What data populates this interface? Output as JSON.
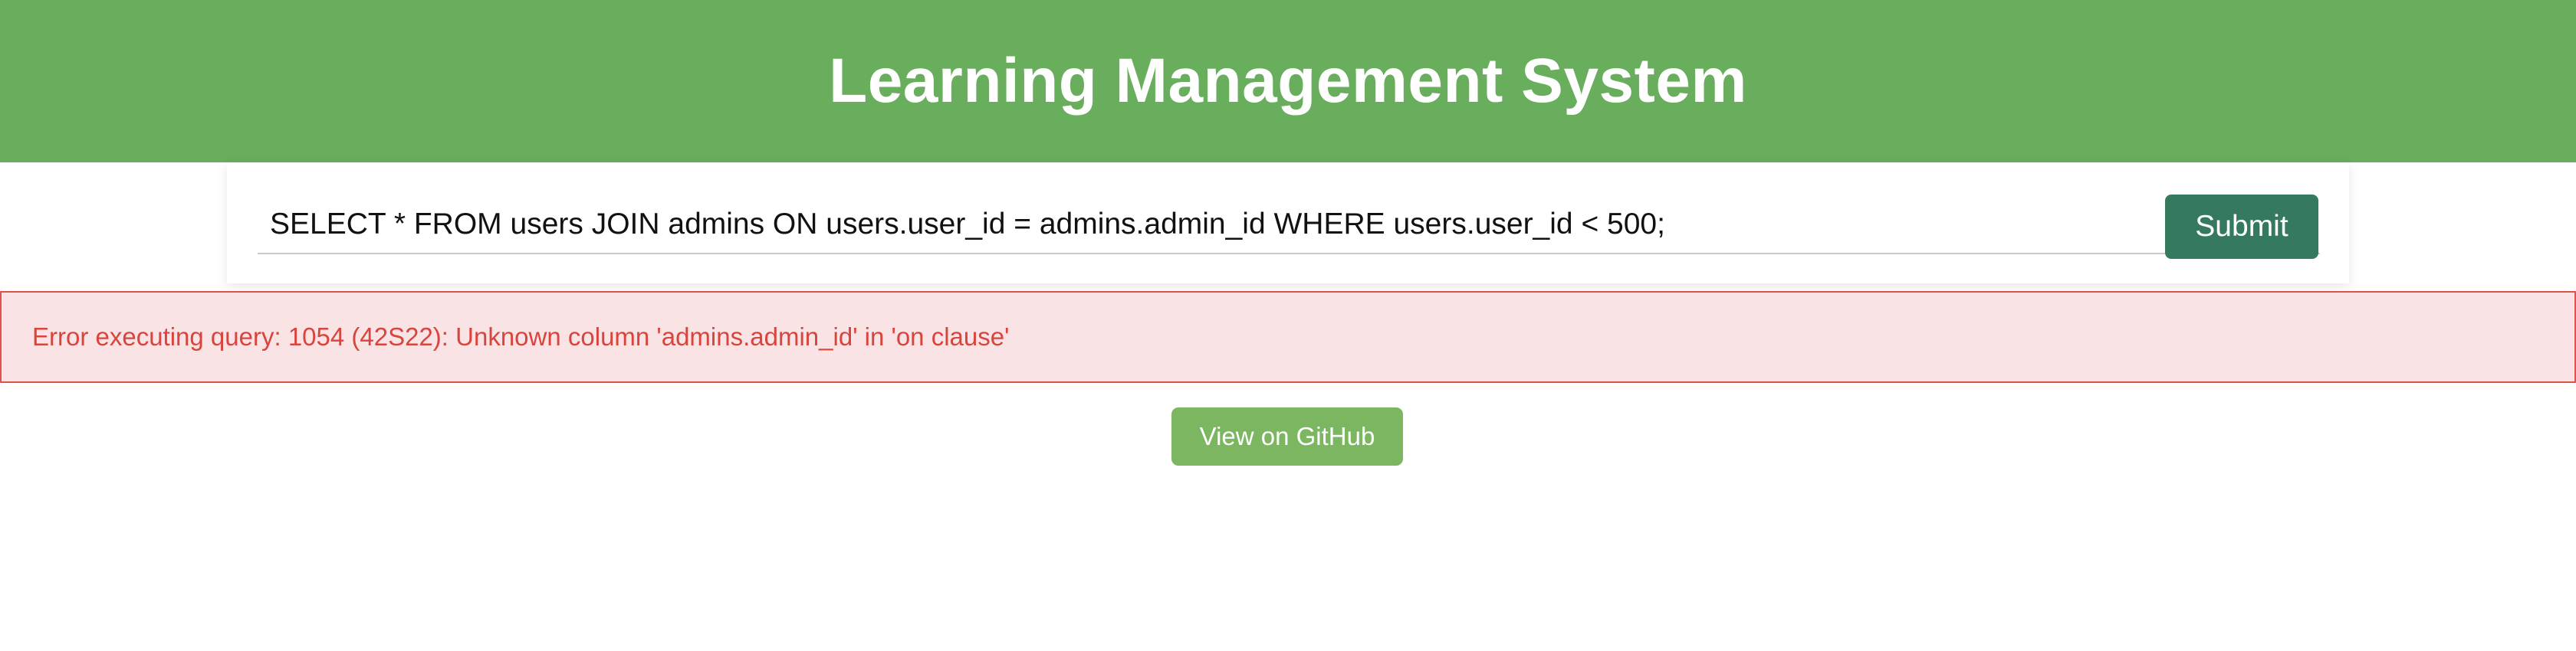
{
  "header": {
    "title": "Learning Management System"
  },
  "query": {
    "value": "SELECT * FROM users JOIN admins ON users.user_id = admins.admin_id WHERE users.user_id < 500;",
    "submit_label": "Submit"
  },
  "error": {
    "message": "Error executing query: 1054 (42S22): Unknown column 'admins.admin_id' in 'on clause'"
  },
  "footer": {
    "github_label": "View on GitHub"
  },
  "colors": {
    "header_bg": "#68ae5d",
    "submit_bg": "#357a5e",
    "error_bg": "#f9e3e4",
    "error_border": "#e0524b",
    "error_text": "#d9443d",
    "github_bg": "#7cb660"
  }
}
